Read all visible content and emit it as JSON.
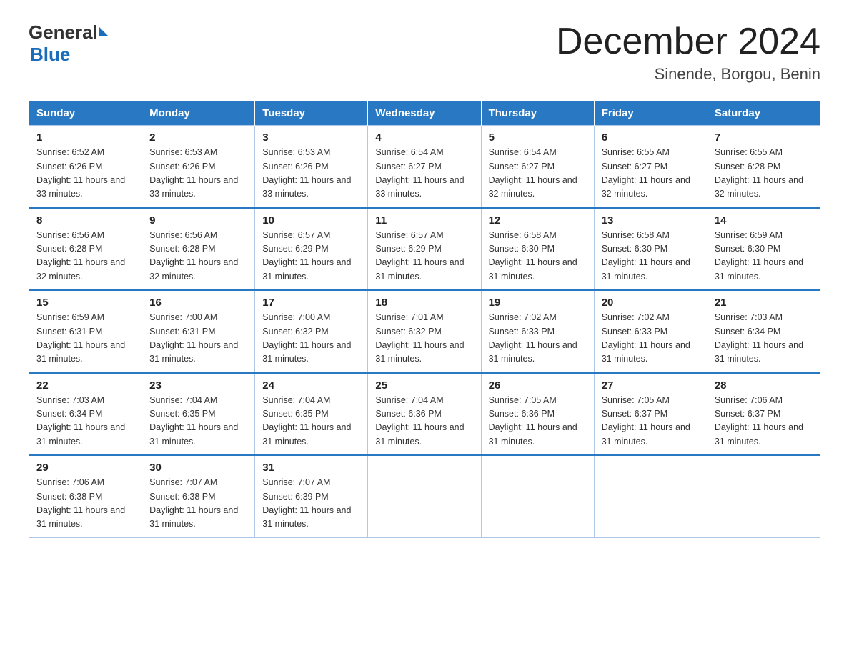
{
  "logo": {
    "general": "General",
    "blue": "Blue"
  },
  "title": "December 2024",
  "subtitle": "Sinende, Borgou, Benin",
  "weekdays": [
    "Sunday",
    "Monday",
    "Tuesday",
    "Wednesday",
    "Thursday",
    "Friday",
    "Saturday"
  ],
  "weeks": [
    [
      {
        "day": "1",
        "sunrise": "6:52 AM",
        "sunset": "6:26 PM",
        "daylight": "11 hours and 33 minutes."
      },
      {
        "day": "2",
        "sunrise": "6:53 AM",
        "sunset": "6:26 PM",
        "daylight": "11 hours and 33 minutes."
      },
      {
        "day": "3",
        "sunrise": "6:53 AM",
        "sunset": "6:26 PM",
        "daylight": "11 hours and 33 minutes."
      },
      {
        "day": "4",
        "sunrise": "6:54 AM",
        "sunset": "6:27 PM",
        "daylight": "11 hours and 33 minutes."
      },
      {
        "day": "5",
        "sunrise": "6:54 AM",
        "sunset": "6:27 PM",
        "daylight": "11 hours and 32 minutes."
      },
      {
        "day": "6",
        "sunrise": "6:55 AM",
        "sunset": "6:27 PM",
        "daylight": "11 hours and 32 minutes."
      },
      {
        "day": "7",
        "sunrise": "6:55 AM",
        "sunset": "6:28 PM",
        "daylight": "11 hours and 32 minutes."
      }
    ],
    [
      {
        "day": "8",
        "sunrise": "6:56 AM",
        "sunset": "6:28 PM",
        "daylight": "11 hours and 32 minutes."
      },
      {
        "day": "9",
        "sunrise": "6:56 AM",
        "sunset": "6:28 PM",
        "daylight": "11 hours and 32 minutes."
      },
      {
        "day": "10",
        "sunrise": "6:57 AM",
        "sunset": "6:29 PM",
        "daylight": "11 hours and 31 minutes."
      },
      {
        "day": "11",
        "sunrise": "6:57 AM",
        "sunset": "6:29 PM",
        "daylight": "11 hours and 31 minutes."
      },
      {
        "day": "12",
        "sunrise": "6:58 AM",
        "sunset": "6:30 PM",
        "daylight": "11 hours and 31 minutes."
      },
      {
        "day": "13",
        "sunrise": "6:58 AM",
        "sunset": "6:30 PM",
        "daylight": "11 hours and 31 minutes."
      },
      {
        "day": "14",
        "sunrise": "6:59 AM",
        "sunset": "6:30 PM",
        "daylight": "11 hours and 31 minutes."
      }
    ],
    [
      {
        "day": "15",
        "sunrise": "6:59 AM",
        "sunset": "6:31 PM",
        "daylight": "11 hours and 31 minutes."
      },
      {
        "day": "16",
        "sunrise": "7:00 AM",
        "sunset": "6:31 PM",
        "daylight": "11 hours and 31 minutes."
      },
      {
        "day": "17",
        "sunrise": "7:00 AM",
        "sunset": "6:32 PM",
        "daylight": "11 hours and 31 minutes."
      },
      {
        "day": "18",
        "sunrise": "7:01 AM",
        "sunset": "6:32 PM",
        "daylight": "11 hours and 31 minutes."
      },
      {
        "day": "19",
        "sunrise": "7:02 AM",
        "sunset": "6:33 PM",
        "daylight": "11 hours and 31 minutes."
      },
      {
        "day": "20",
        "sunrise": "7:02 AM",
        "sunset": "6:33 PM",
        "daylight": "11 hours and 31 minutes."
      },
      {
        "day": "21",
        "sunrise": "7:03 AM",
        "sunset": "6:34 PM",
        "daylight": "11 hours and 31 minutes."
      }
    ],
    [
      {
        "day": "22",
        "sunrise": "7:03 AM",
        "sunset": "6:34 PM",
        "daylight": "11 hours and 31 minutes."
      },
      {
        "day": "23",
        "sunrise": "7:04 AM",
        "sunset": "6:35 PM",
        "daylight": "11 hours and 31 minutes."
      },
      {
        "day": "24",
        "sunrise": "7:04 AM",
        "sunset": "6:35 PM",
        "daylight": "11 hours and 31 minutes."
      },
      {
        "day": "25",
        "sunrise": "7:04 AM",
        "sunset": "6:36 PM",
        "daylight": "11 hours and 31 minutes."
      },
      {
        "day": "26",
        "sunrise": "7:05 AM",
        "sunset": "6:36 PM",
        "daylight": "11 hours and 31 minutes."
      },
      {
        "day": "27",
        "sunrise": "7:05 AM",
        "sunset": "6:37 PM",
        "daylight": "11 hours and 31 minutes."
      },
      {
        "day": "28",
        "sunrise": "7:06 AM",
        "sunset": "6:37 PM",
        "daylight": "11 hours and 31 minutes."
      }
    ],
    [
      {
        "day": "29",
        "sunrise": "7:06 AM",
        "sunset": "6:38 PM",
        "daylight": "11 hours and 31 minutes."
      },
      {
        "day": "30",
        "sunrise": "7:07 AM",
        "sunset": "6:38 PM",
        "daylight": "11 hours and 31 minutes."
      },
      {
        "day": "31",
        "sunrise": "7:07 AM",
        "sunset": "6:39 PM",
        "daylight": "11 hours and 31 minutes."
      },
      null,
      null,
      null,
      null
    ]
  ]
}
